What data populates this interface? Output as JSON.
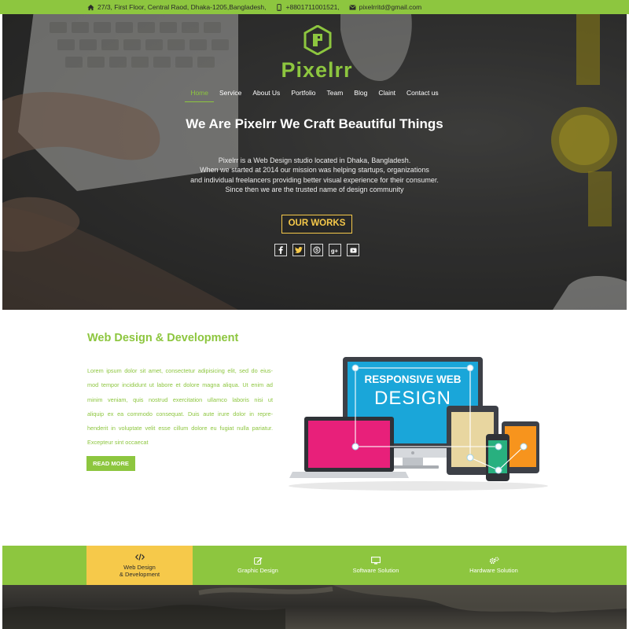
{
  "contact": {
    "address": "27/3, First Floor, Central Raod, Dhaka-1205,Bangladesh,",
    "phone": "+8801711001521,",
    "email": "pixelrritd@gmail.com"
  },
  "brand": {
    "name": "Pixelrr",
    "color": "#8dc63f",
    "accent": "#f6c94a"
  },
  "nav": [
    {
      "label": "Home",
      "active": true
    },
    {
      "label": "Service"
    },
    {
      "label": "About Us"
    },
    {
      "label": "Portfolio"
    },
    {
      "label": "Team"
    },
    {
      "label": "Blog"
    },
    {
      "label": "Claint"
    },
    {
      "label": "Contact us"
    }
  ],
  "hero": {
    "title": "We Are Pixelrr We Craft Beautiful Things",
    "desc_lines": [
      "Pixelrr is a Web Design studio located in Dhaka, Bangladesh.",
      "When we started at 2014 our mission was helping startups, organizations",
      "and individual freelancers providing better visual experience for their consumer.",
      "Since then we are the trusted name of design community"
    ],
    "cta_label": "OUR WORKS"
  },
  "socials": [
    {
      "icon": "facebook-icon",
      "glyph": "f"
    },
    {
      "icon": "twitter-icon",
      "glyph": "🐦"
    },
    {
      "icon": "skype-icon",
      "glyph": "S"
    },
    {
      "icon": "google-plus-icon",
      "glyph": "g+"
    },
    {
      "icon": "youtube-icon",
      "glyph": "▶"
    }
  ],
  "feature": {
    "title": "Web Design & Development",
    "text_lines": [
      "Lorem ipsum dolor sit amet, consectetur adipisicing elit, sed do eius-",
      "mod tempor incididunt ut labore et dolore magna aliqua. Ut enim ad",
      "minim veniam, quis nostrud exercitation ullamco laboris nisi ut",
      "aliquip ex ea commodo consequat. Duis aute irure dolor in repre-",
      "henderit in voluptate velit esse cillum dolore eu fugiat nulla pariatur.",
      "Excepteur sint occaecat"
    ],
    "read_more": "READ MORE",
    "illustration_text": {
      "line1": "RESPONSIVE WEB",
      "line2": "DESIGN"
    }
  },
  "tabs": [
    {
      "line1": "Web Design",
      "line2": "& Development",
      "icon": "code-icon",
      "active": true
    },
    {
      "line1": "Graphic Design",
      "line2": "",
      "icon": "pencil-square-icon"
    },
    {
      "line1": "Software Solution",
      "line2": "",
      "icon": "monitor-icon"
    },
    {
      "line1": "Hardware Solution",
      "line2": "",
      "icon": "gears-icon"
    }
  ]
}
